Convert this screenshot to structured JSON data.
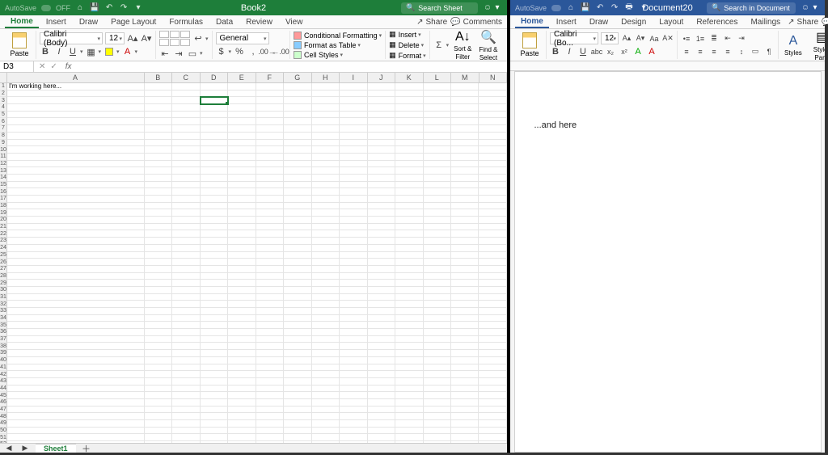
{
  "excel": {
    "titlebar": {
      "autosave": "AutoSave",
      "autosave_state": "OFF",
      "title": "Book2",
      "search_ph": "Search Sheet"
    },
    "tabs": [
      "Home",
      "Insert",
      "Draw",
      "Page Layout",
      "Formulas",
      "Data",
      "Review",
      "View"
    ],
    "share": "Share",
    "comments": "Comments",
    "ribbon": {
      "paste": "Paste",
      "font_name": "Calibri (Body)",
      "font_size": "12",
      "number_format": "General",
      "cond_fmt": "Conditional Formatting",
      "as_table": "Format as Table",
      "cell_styles": "Cell Styles",
      "insert": "Insert",
      "delete": "Delete",
      "format": "Format",
      "sort": "Sort &",
      "filter": "Filter",
      "find": "Find &",
      "select": "Select"
    },
    "name_box": "D3",
    "columns": [
      "A",
      "B",
      "C",
      "D",
      "E",
      "F",
      "G",
      "H",
      "I",
      "J",
      "K",
      "L",
      "M",
      "N"
    ],
    "a1_text": "I'm working here...",
    "selected_cell": "D3",
    "sheet_tab": "Sheet1",
    "row_count": 52
  },
  "word": {
    "titlebar": {
      "autosave": "AutoSave",
      "title": "Document20",
      "search_ph": "Search in Document"
    },
    "tabs": [
      "Home",
      "Insert",
      "Draw",
      "Design",
      "Layout",
      "References",
      "Mailings"
    ],
    "share": "Share",
    "comments": "Comments",
    "ribbon": {
      "paste": "Paste",
      "font_name": "Calibri (Bo...",
      "font_size": "12",
      "styles": "Styles",
      "styles_pane": "Styles",
      "pane": "Pane"
    },
    "body_text": "...and here"
  }
}
